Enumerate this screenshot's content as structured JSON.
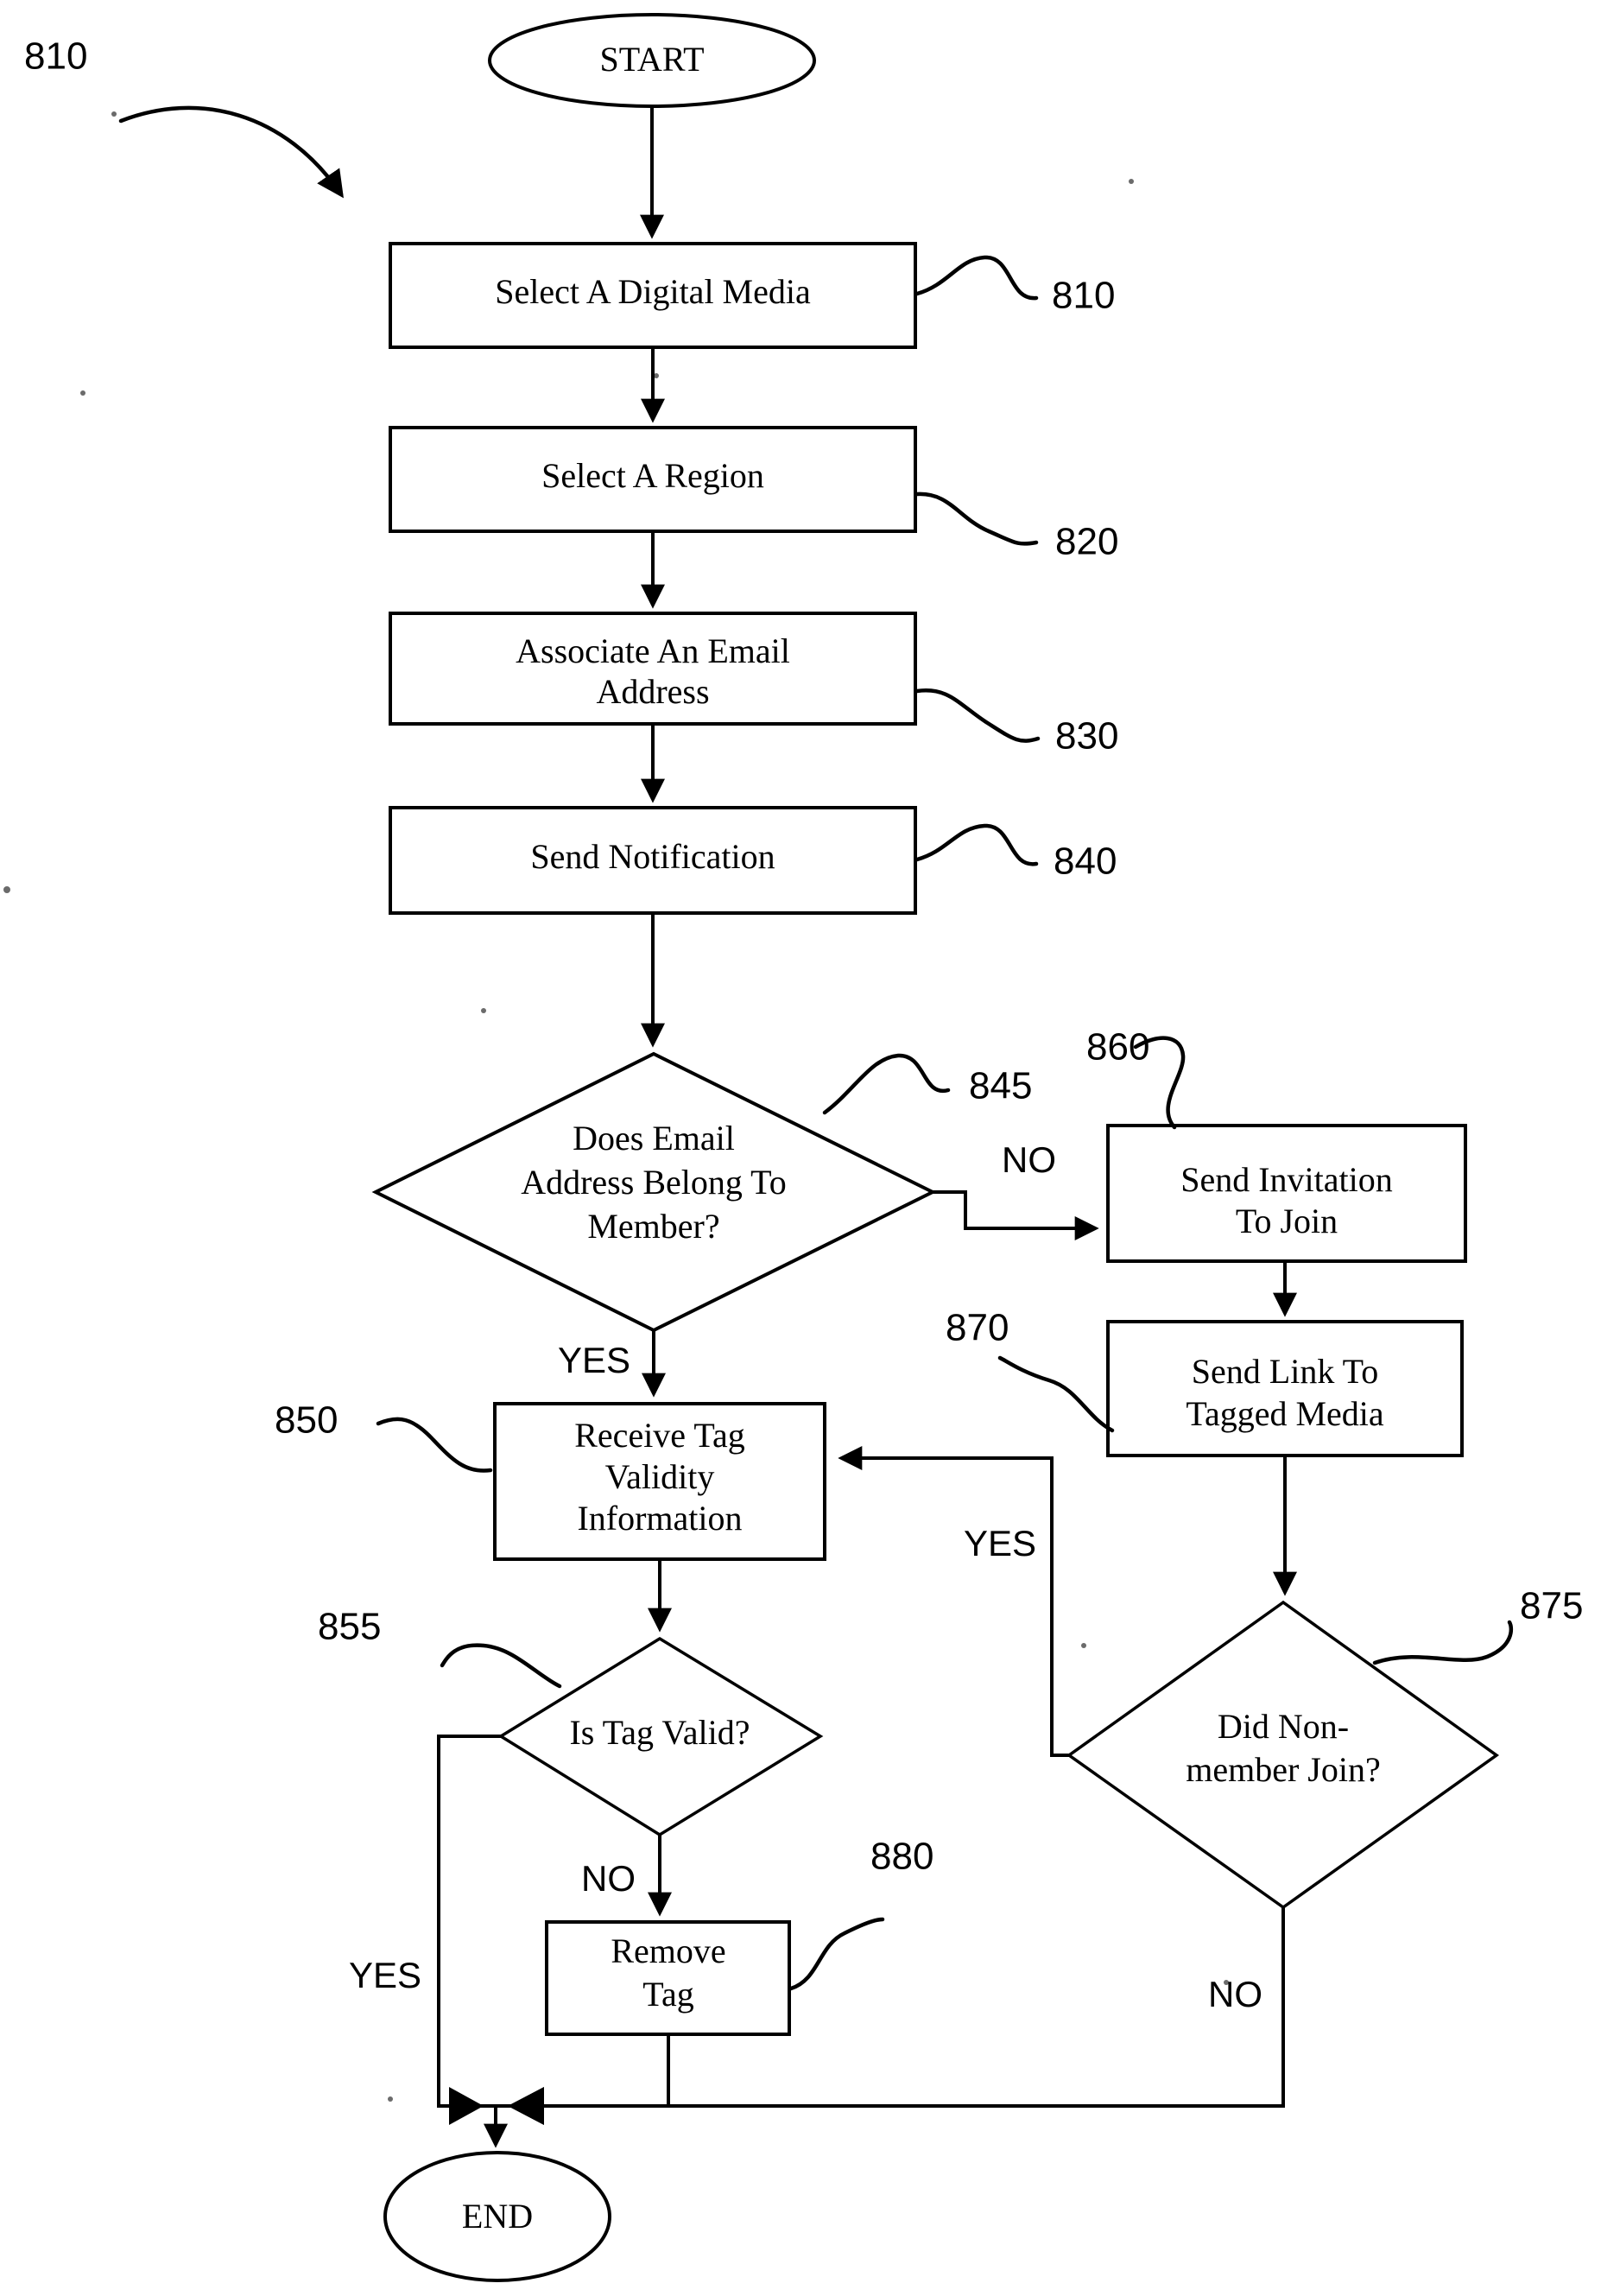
{
  "figure": {
    "main_reference": "810"
  },
  "nodes": {
    "start": {
      "id": "start",
      "label": "START",
      "shape": "ellipse"
    },
    "end": {
      "id": "end",
      "label": "END",
      "shape": "ellipse"
    },
    "select_media": {
      "id": "810",
      "label": "Select A Digital Media",
      "shape": "process",
      "ref": "810"
    },
    "select_region": {
      "id": "820",
      "label": "Select A Region",
      "shape": "process",
      "ref": "820"
    },
    "associate_email": {
      "id": "830",
      "label_line1": "Associate An Email",
      "label_line2": "Address",
      "shape": "process",
      "ref": "830"
    },
    "send_notification": {
      "id": "840",
      "label": "Send Notification",
      "shape": "process",
      "ref": "840"
    },
    "email_member_decision": {
      "id": "845",
      "label_line1": "Does Email",
      "label_line2": "Address Belong To",
      "label_line3": "Member?",
      "shape": "decision",
      "ref": "845"
    },
    "send_invitation": {
      "id": "860",
      "label_line1": "Send Invitation",
      "label_line2": "To Join",
      "shape": "process",
      "ref": "860"
    },
    "send_link": {
      "id": "870",
      "label_line1": "Send Link To",
      "label_line2": "Tagged Media",
      "shape": "process",
      "ref": "870"
    },
    "nonmember_join_decision": {
      "id": "875",
      "label_line1": "Did Non-",
      "label_line2": "member Join?",
      "shape": "decision",
      "ref": "875"
    },
    "receive_tag_validity": {
      "id": "850",
      "label_line1": "Receive Tag",
      "label_line2": "Validity",
      "label_line3": "Information",
      "shape": "process",
      "ref": "850"
    },
    "tag_valid_decision": {
      "id": "855",
      "label": "Is Tag Valid?",
      "shape": "decision",
      "ref": "855"
    },
    "remove_tag": {
      "id": "880",
      "label_line1": "Remove",
      "label_line2": "Tag",
      "shape": "process",
      "ref": "880"
    }
  },
  "edge_labels": {
    "email_no": "NO",
    "email_yes": "YES",
    "nonmember_yes": "YES",
    "nonmember_no": "NO",
    "tag_valid_yes": "YES",
    "tag_valid_no": "NO"
  },
  "reference_numerals": {
    "figure_leader": "810",
    "select_media": "810",
    "select_region": "820",
    "associate_email": "830",
    "send_notification": "840",
    "email_member_decision": "845",
    "receive_tag_validity": "850",
    "tag_valid_decision": "855",
    "send_invitation": "860",
    "send_link": "870",
    "nonmember_join_decision": "875",
    "remove_tag": "880"
  },
  "colors": {
    "ink": "#000000",
    "paper": "#ffffff"
  }
}
